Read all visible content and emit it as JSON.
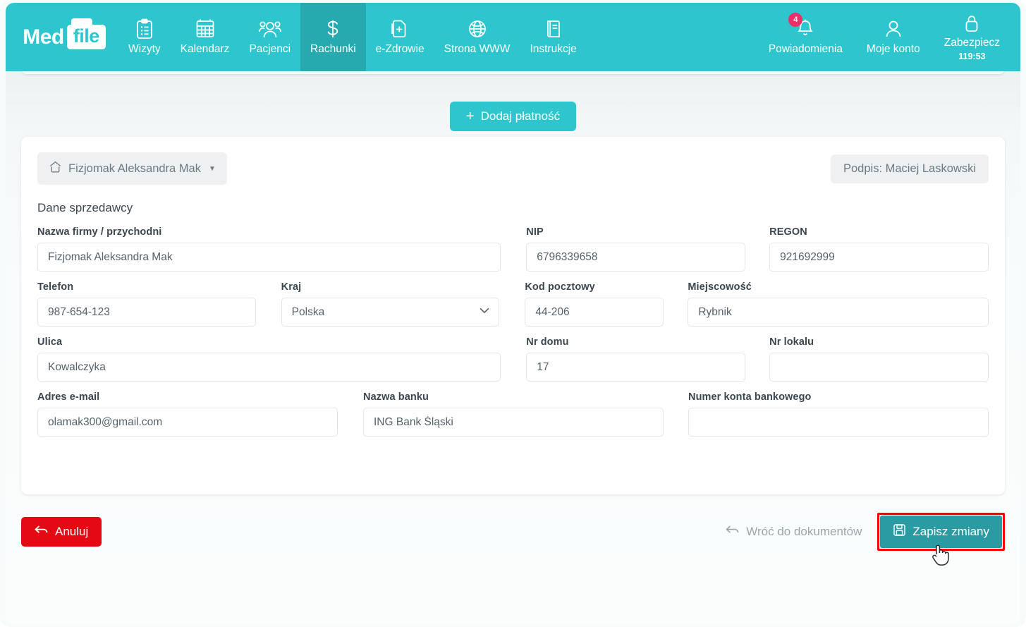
{
  "brand": {
    "med": "Med",
    "file": "file"
  },
  "nav": {
    "items": [
      {
        "label": "Wizyty",
        "icon": "clipboard-icon",
        "active": false
      },
      {
        "label": "Kalendarz",
        "icon": "calendar-icon",
        "active": false
      },
      {
        "label": "Pacjenci",
        "icon": "users-icon",
        "active": false
      },
      {
        "label": "Rachunki",
        "icon": "dollar-icon",
        "active": true
      },
      {
        "label": "e-Zdrowie",
        "icon": "medical-file-icon",
        "active": false
      },
      {
        "label": "Strona WWW",
        "icon": "globe-icon",
        "active": false
      },
      {
        "label": "Instrukcje",
        "icon": "book-icon",
        "active": false
      }
    ],
    "right": {
      "notifications": {
        "label": "Powiadomienia",
        "icon": "bell-icon",
        "badge": "4"
      },
      "account": {
        "label": "Moje konto",
        "icon": "user-icon"
      },
      "lock": {
        "label": "Zabezpiecz",
        "icon": "lock-icon",
        "timer": "119:53"
      }
    }
  },
  "toolbar": {
    "add_payment_label": "Dodaj płatność",
    "add_payment_icon": "plus-icon"
  },
  "card": {
    "clinic_selector": {
      "label": "Fizjomak Aleksandra Mak",
      "icon": "home-icon",
      "caret": "chevron-down-icon"
    },
    "signature": "Podpis: Maciej Laskowski",
    "section_title": "Dane sprzedawcy"
  },
  "form": {
    "company_name": {
      "label": "Nazwa firmy / przychodni",
      "value": "Fizjomak Aleksandra Mak",
      "placeholder": ""
    },
    "nip": {
      "label": "NIP",
      "value": "6796339658",
      "placeholder": ""
    },
    "regon": {
      "label": "REGON",
      "value": "921692999",
      "placeholder": ""
    },
    "phone": {
      "label": "Telefon",
      "value": "987-654-123",
      "placeholder": ""
    },
    "country": {
      "label": "Kraj",
      "value": "Polska",
      "options": [
        "Polska"
      ]
    },
    "postal_code": {
      "label": "Kod pocztowy",
      "value": "44-206",
      "placeholder": ""
    },
    "city": {
      "label": "Miejscowość",
      "value": "Rybnik",
      "placeholder": ""
    },
    "street": {
      "label": "Ulica",
      "value": "Kowalczyka",
      "placeholder": ""
    },
    "house_no": {
      "label": "Nr domu",
      "value": "17",
      "placeholder": ""
    },
    "flat_no": {
      "label": "Nr lokalu",
      "value": "",
      "placeholder": ""
    },
    "email": {
      "label": "Adres e-mail",
      "value": "olamak300@gmail.com",
      "placeholder": ""
    },
    "bank_name": {
      "label": "Nazwa banku",
      "value": "ING Bank Śląski",
      "placeholder": ""
    },
    "bank_account": {
      "label": "Numer konta bankowego",
      "value": "",
      "placeholder": ""
    }
  },
  "footer": {
    "cancel": {
      "label": "Anuluj",
      "icon": "arrow-back-icon"
    },
    "back_to_documents": {
      "label": "Wróć do dokumentów",
      "icon": "arrow-back-icon"
    },
    "save": {
      "label": "Zapisz zmiany",
      "icon": "floppy-disk-icon"
    }
  },
  "colors": {
    "brand_teal": "#2ec6ce",
    "active_teal": "#27a9b0",
    "save_teal": "#2b9ba3",
    "danger_red": "#e50914",
    "highlight_red": "#ff0000",
    "badge_pink": "#ec2f66"
  }
}
